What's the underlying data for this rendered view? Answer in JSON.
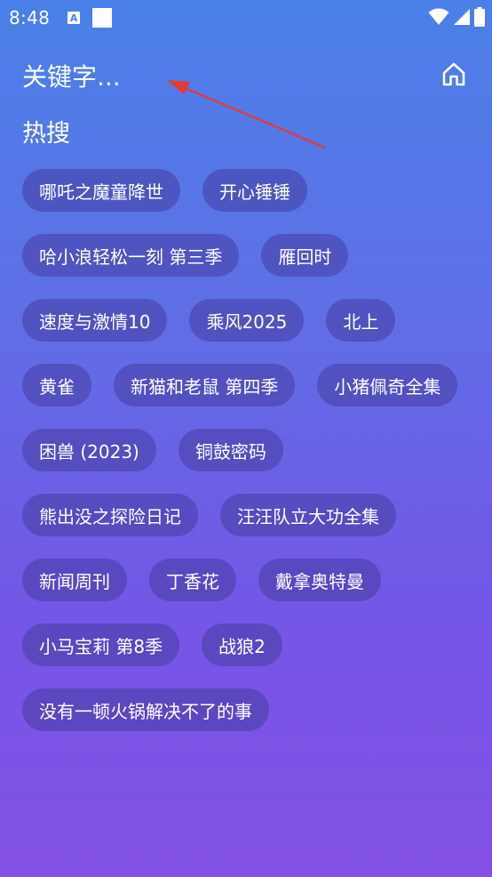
{
  "status_bar": {
    "time": "8:48",
    "icons": [
      "notification-a-icon",
      "notification-square-icon",
      "wifi-icon",
      "signal-icon",
      "battery-icon"
    ]
  },
  "search": {
    "placeholder": "关键字..."
  },
  "section": {
    "title": "热搜"
  },
  "hot_searches": [
    "哪吒之魔童降世",
    "开心锤锤",
    "哈小浪轻松一刻 第三季",
    "雁回时",
    "速度与激情10",
    "乘风2025",
    "北上",
    "黄雀",
    "新猫和老鼠 第四季",
    "小猪佩奇全集",
    "困兽 (2023)",
    "铜鼓密码",
    "熊出没之探险日记",
    "汪汪队立大功全集",
    "新闻周刊",
    "丁香花",
    "戴拿奥特曼",
    "小马宝莉 第8季",
    "战狼2",
    "没有一顿火锅解决不了的事"
  ],
  "colors": {
    "background_top": "#4a80e8",
    "background_bottom": "#8451e6",
    "chip_background": "#463ca0",
    "annotation_arrow": "#e53935"
  }
}
